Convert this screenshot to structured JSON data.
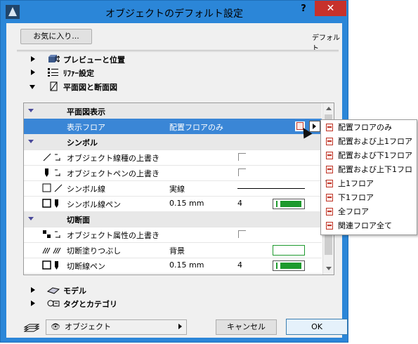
{
  "window": {
    "title": "オブジェクトのデフォルト設定",
    "help_label": "?",
    "close_label": "✕"
  },
  "toolbar": {
    "favorites_label": "お気に入り...",
    "default_label": "デフォルト"
  },
  "sections": {
    "preview": "プレビューと位置",
    "parameters": "ﾘﾌｧｰ設定",
    "plan_section": "平面図と断面図",
    "model": "モデル",
    "tags": "タグとカテゴリ"
  },
  "panel": {
    "group_display": "平面図表示",
    "show_floor": {
      "label": "表示フロア",
      "value": "配置フロアのみ"
    },
    "group_symbol": "シンボル",
    "override_line": "オブジェクト線種の上書き",
    "override_pen": "オブジェクトペンの上書き",
    "symbol_line": {
      "label": "シンボル線",
      "value": "実線"
    },
    "symbol_pen": {
      "label": "シンボル線ペン",
      "value": "0.15 mm",
      "pen_no": "4"
    },
    "group_cut": "切断面",
    "override_attr": "オブジェクト属性の上書き",
    "cut_fill": {
      "label": "切断塗りつぶし",
      "value": "背景"
    },
    "cut_pen": {
      "label": "切断線ペン",
      "value": "0.15 mm",
      "pen_no": "4"
    }
  },
  "floor_menu": [
    "配置フロアのみ",
    "配置および上1フロア",
    "配置および下1フロア",
    "配置および上下1フロア",
    "上1フロア",
    "下1フロア",
    "全フロア",
    "関連フロア全て"
  ],
  "bottom": {
    "object_layer": "オブジェクト",
    "cancel_label": "キャンセル",
    "ok_label": "OK"
  },
  "colors": {
    "selection": "#3a86d6",
    "pen_green": "#1e9a2e",
    "title_bar": "#2b86d8",
    "close_red": "#c7312b"
  }
}
